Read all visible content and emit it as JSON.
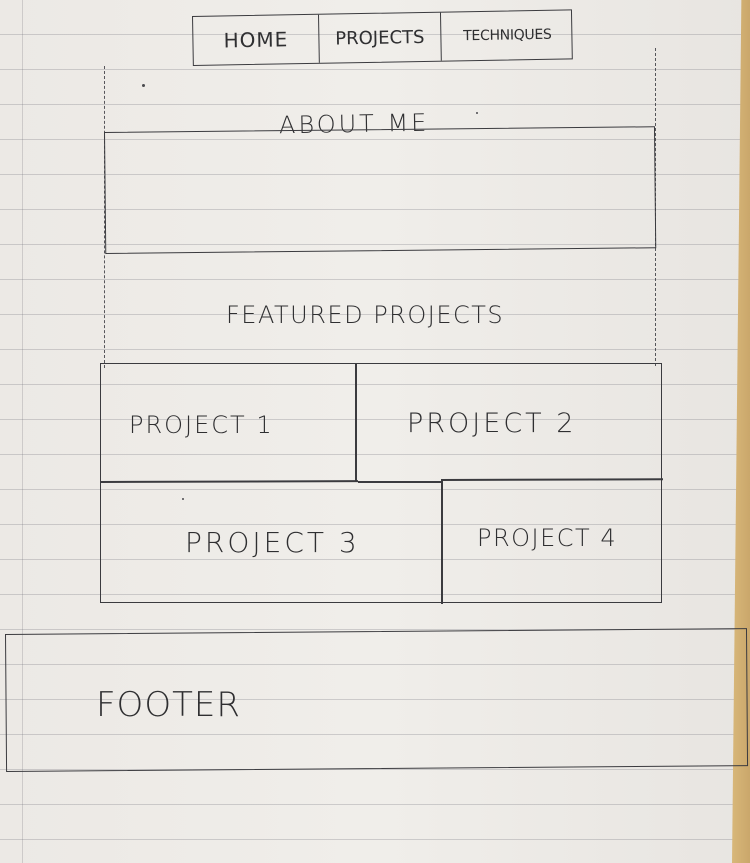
{
  "navigation": {
    "items": [
      {
        "label": "HOME"
      },
      {
        "label": "PROJECTS"
      },
      {
        "label": "TECHNIQUES"
      }
    ]
  },
  "about": {
    "title": "ABOUT ME"
  },
  "featured": {
    "title": "FEATURED PROJECTS",
    "projects": [
      {
        "label": "PROJECT 1"
      },
      {
        "label": "PROJECT 2"
      },
      {
        "label": "PROJECT 3"
      },
      {
        "label": "PROJECT 4"
      }
    ]
  },
  "footer": {
    "label": "FOOTER"
  }
}
